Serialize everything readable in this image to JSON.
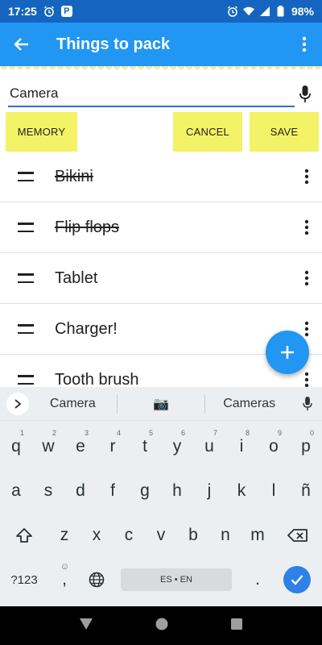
{
  "status_bar": {
    "time": "17:25",
    "battery": "98%",
    "left_icons": [
      "alarm-icon",
      "p-badge-icon"
    ],
    "right_icons": [
      "alarm-icon",
      "wifi-icon",
      "signal-icon",
      "battery-icon"
    ]
  },
  "app_bar": {
    "title": "Things to pack",
    "back_icon": "arrow-left-icon",
    "menu_icon": "more-vertical-icon"
  },
  "input": {
    "value": "Camera",
    "mic_icon": "mic-icon"
  },
  "buttons": {
    "memory": "MEMORY",
    "cancel": "CANCEL",
    "save": "SAVE"
  },
  "list": {
    "items": [
      {
        "label": "Bikini",
        "done": true
      },
      {
        "label": "Flip flops",
        "done": true
      },
      {
        "label": "Tablet",
        "done": false
      },
      {
        "label": "Charger!",
        "done": false
      },
      {
        "label": "Tooth brush",
        "done": false
      }
    ]
  },
  "fab": {
    "icon": "plus-icon"
  },
  "keyboard": {
    "suggestions": [
      "Camera",
      "📷",
      "Cameras"
    ],
    "row1": [
      {
        "k": "q",
        "h": "1"
      },
      {
        "k": "w",
        "h": "2"
      },
      {
        "k": "e",
        "h": "3"
      },
      {
        "k": "r",
        "h": "4"
      },
      {
        "k": "t",
        "h": "5"
      },
      {
        "k": "y",
        "h": "6"
      },
      {
        "k": "u",
        "h": "7"
      },
      {
        "k": "i",
        "h": "8"
      },
      {
        "k": "o",
        "h": "9"
      },
      {
        "k": "p",
        "h": "0"
      }
    ],
    "row2": [
      "a",
      "s",
      "d",
      "f",
      "g",
      "h",
      "j",
      "k",
      "l",
      "ñ"
    ],
    "row3": [
      "z",
      "x",
      "c",
      "v",
      "b",
      "n",
      "m"
    ],
    "sym_key": "?123",
    "comma_key": ",",
    "period_key": ".",
    "space_label": "ES • EN"
  },
  "colors": {
    "status_bar": "#1565c0",
    "app_bar": "#2196f3",
    "button_yellow": "#f4f266",
    "fab": "#2196f3",
    "keyboard_bg": "#eceff1",
    "enter_key": "#2f80e7"
  }
}
